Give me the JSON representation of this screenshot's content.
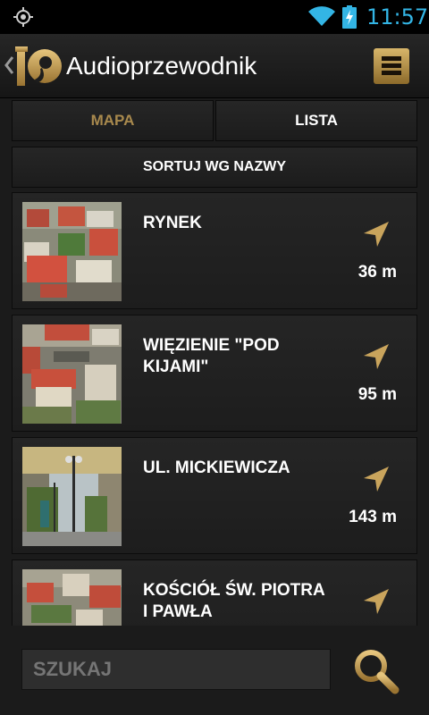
{
  "status_bar": {
    "time": "11:57",
    "icons": [
      "gps-icon",
      "wifi-icon",
      "battery-charging-icon"
    ],
    "time_color": "#33b5e5"
  },
  "action_bar": {
    "title": "Audioprzewodnik",
    "back_icon": "chevron-left-icon",
    "logo_icon": "audio-guide-logo",
    "menu_icon": "menu-icon"
  },
  "tabs": [
    {
      "label": "MAPA",
      "active": false
    },
    {
      "label": "LISTA",
      "active": true
    }
  ],
  "sort_label": "SORTUJ WG NAZWY",
  "items": [
    {
      "name": "RYNEK",
      "distance": "36 m"
    },
    {
      "name": "WIĘZIENIE \"POD KIJAMI\"",
      "distance": "95 m"
    },
    {
      "name": "UL. MICKIEWICZA",
      "distance": "143 m"
    },
    {
      "name": "KOŚCIÓŁ ŚW. PIOTRA I PAWŁA",
      "distance": ""
    }
  ],
  "search": {
    "placeholder": "SZUKAJ",
    "button_icon": "search-icon"
  },
  "colors": {
    "accent_gold": "#c9a45c",
    "tab_inactive_text": "#a8894d"
  }
}
